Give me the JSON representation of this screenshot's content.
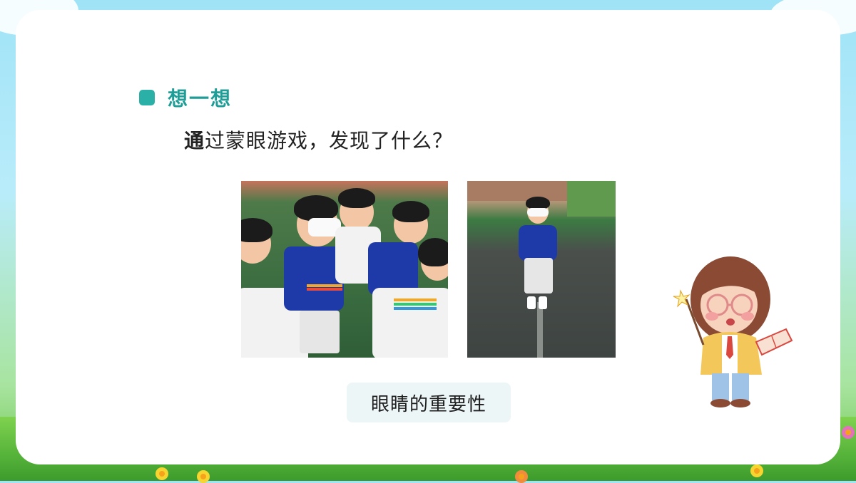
{
  "section": {
    "heading": "想一想"
  },
  "question": {
    "first_char": "通",
    "rest": "过蒙眼游戏，发现了什么？"
  },
  "photos": [
    {
      "name": "children-blindfold-game-group"
    },
    {
      "name": "child-blindfolded-standing"
    }
  ],
  "answer_label": "眼睛的重要性",
  "colors": {
    "accent": "#2bb0a8",
    "heading": "#1f9e97",
    "label_bg": "#edf6f7"
  }
}
